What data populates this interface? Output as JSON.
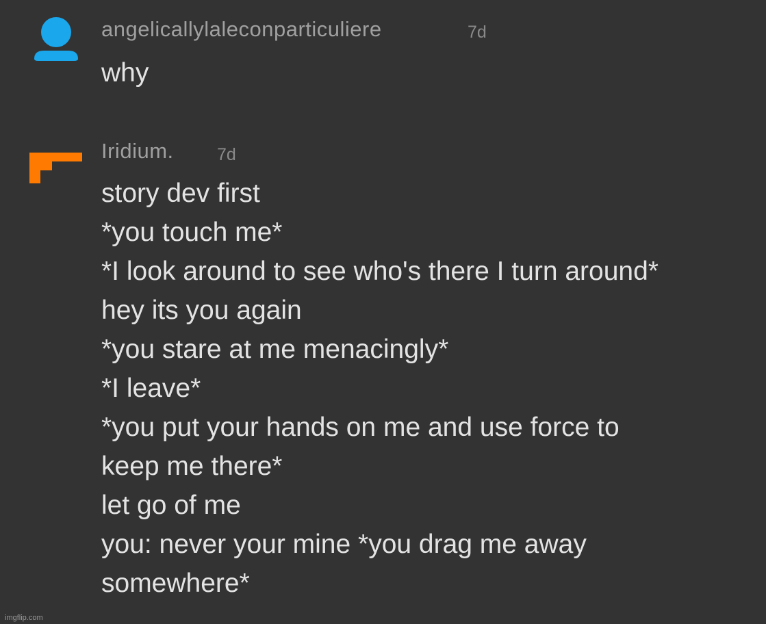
{
  "comments": [
    {
      "username": "angelicallylaleconparticuliere",
      "time": "7d",
      "avatar_icon": "person-icon",
      "avatar_color": "#1aa7ec",
      "lines": [
        "why"
      ]
    },
    {
      "username": "Iridium.",
      "time": "7d",
      "avatar_icon": "pixel-corner-icon",
      "avatar_color": "#ff7a00",
      "lines": [
        "story dev first",
        "*you touch me*",
        "*I look around to see who's there I turn around*",
        "hey its you again",
        "*you stare at me menacingly*",
        "*I leave*",
        "*you put your hands on me and use force to",
        "keep me there*",
        "let go of me",
        "you: never your mine *you drag me away",
        "somewhere*"
      ]
    }
  ],
  "watermark": "imgflip.com"
}
